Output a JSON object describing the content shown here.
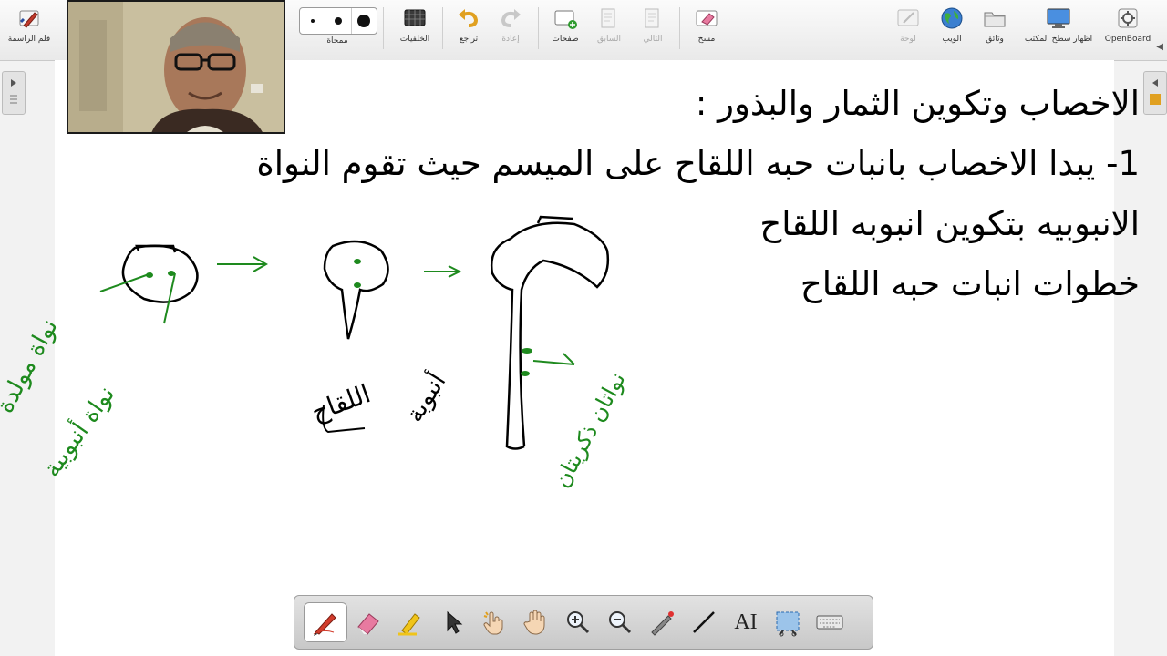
{
  "toolbar": {
    "left": [
      {
        "label": "قلم الراسمة",
        "icon": "stylus-pen-icon",
        "disabled": false
      },
      {
        "label": "ممحاة",
        "icon": "pen-size-selector",
        "disabled": false
      },
      {
        "label": "الخلفيات",
        "icon": "backgrounds-icon",
        "disabled": false
      },
      {
        "label": "تراجع",
        "icon": "undo-icon",
        "disabled": false
      },
      {
        "label": "إعادة",
        "icon": "redo-icon",
        "disabled": true
      },
      {
        "label": "صفحات",
        "icon": "add-page-icon",
        "disabled": false
      },
      {
        "label": "السابق",
        "icon": "previous-page-icon",
        "disabled": true
      },
      {
        "label": "التالي",
        "icon": "next-page-icon",
        "disabled": true
      },
      {
        "label": "مسح",
        "icon": "erase-board-icon",
        "disabled": false
      }
    ],
    "right": [
      {
        "label": "لوحة",
        "icon": "board-icon",
        "disabled": true
      },
      {
        "label": "الويب",
        "icon": "web-globe-icon",
        "disabled": false
      },
      {
        "label": "وثائق",
        "icon": "documents-folder-icon",
        "disabled": false
      },
      {
        "label": "اظهار سطح المكتب",
        "icon": "show-desktop-icon",
        "disabled": false
      },
      {
        "label": "OpenBoard",
        "icon": "openboard-menu-icon",
        "disabled": false
      }
    ]
  },
  "board": {
    "lines": [
      "الاخصاب وتكوين الثمار والبذور :",
      "1- يبدا الاخصاب بانبات حبه اللقاح على الميسم حيث تقوم النواة",
      "الانبوبيه بتكوين انبوبه اللقاح",
      "خطوات انبات حبه اللقاح"
    ],
    "handwriting": [
      "نواة مولدة",
      "نواة أنبوبية",
      "أنبوبة",
      "اللقاح",
      "نواتان ذكريتان"
    ]
  },
  "palette": {
    "tools": [
      {
        "icon": "pen-tool-icon",
        "active": true
      },
      {
        "icon": "eraser-tool-icon",
        "active": false
      },
      {
        "icon": "highlighter-tool-icon",
        "active": false
      },
      {
        "icon": "select-arrow-icon",
        "active": false
      },
      {
        "icon": "interact-hand-icon",
        "active": false
      },
      {
        "icon": "pan-hand-icon",
        "active": false
      },
      {
        "icon": "zoom-in-icon",
        "active": false
      },
      {
        "icon": "zoom-out-icon",
        "active": false
      },
      {
        "icon": "laser-pointer-icon",
        "active": false
      },
      {
        "icon": "line-tool-icon",
        "active": false
      },
      {
        "icon": "text-tool-icon",
        "active": false
      },
      {
        "icon": "capture-tool-icon",
        "active": false
      },
      {
        "icon": "virtual-keyboard-icon",
        "active": false
      }
    ],
    "text_tool_label": "AI"
  },
  "colors": {
    "ink_black": "#000000",
    "ink_green": "#1e8a1e",
    "toolbar_bg": "#efefef",
    "board_bg": "#ffffff"
  }
}
